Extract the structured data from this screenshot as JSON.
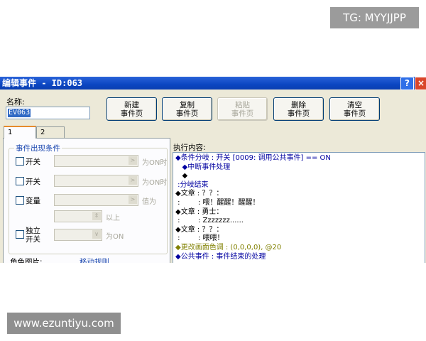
{
  "overlay": {
    "tg_label": "TG: MYYJJPP",
    "site_label": "www.ezuntiyu.com"
  },
  "window": {
    "title": "编辑事件 - ID:063",
    "help_icon": "?",
    "close_icon": "×",
    "name_label": "名称:",
    "name_value": "EV063",
    "buttons": {
      "new_page": [
        "新建",
        "事件页"
      ],
      "copy_page": [
        "复制",
        "事件页"
      ],
      "paste_page": [
        "粘贴",
        "事件页"
      ],
      "delete_page": [
        "删除",
        "事件页"
      ],
      "clear_page": [
        "清空",
        "事件页"
      ]
    },
    "tabs": [
      "1",
      "2"
    ],
    "conditions": {
      "group_title": "事件出现条件",
      "switch1_label": "开关",
      "switch1_suffix": "为ON时",
      "switch2_label": "开关",
      "switch2_suffix": "为ON时",
      "variable_label": "变量",
      "variable_suffix": "值为",
      "above_label": "以上",
      "self_switch_label": [
        "独立",
        "开关"
      ],
      "self_switch_suffix": "为ON"
    },
    "character_image_label": "角色图片:",
    "move_route_label": "移动规则",
    "exec_label": "执行内容:",
    "exec_lines": [
      {
        "text": "◆条件分岐 : 开关 [0009: 调用公共事件] == ON",
        "color": "blue"
      },
      {
        "text": "   ◆中断事件处理",
        "color": "blue"
      },
      {
        "text": "   ◆",
        "color": "black"
      },
      {
        "text": " :分岐结束",
        "color": "blue"
      },
      {
        "text": "◆文章 : ？？：",
        "color": "black"
      },
      {
        "text": " :        : 喂！醒醒！醒醒！",
        "color": "black"
      },
      {
        "text": "◆文章 : 勇士：",
        "color": "black"
      },
      {
        "text": " :        : Zzzzzzz......",
        "color": "black"
      },
      {
        "text": "◆文章 : ？？：",
        "color": "black"
      },
      {
        "text": " :        : 喂喂！",
        "color": "black"
      },
      {
        "text": "◆更改画面色调 : (0,0,0,0), @20",
        "color": "olive"
      },
      {
        "text": "◆公共事件 : 事件结束的处理",
        "color": "blue"
      }
    ]
  },
  "colors": {
    "titlebar": "#0b46c2",
    "text_blue": "#0000a0",
    "text_olive": "#808000"
  }
}
